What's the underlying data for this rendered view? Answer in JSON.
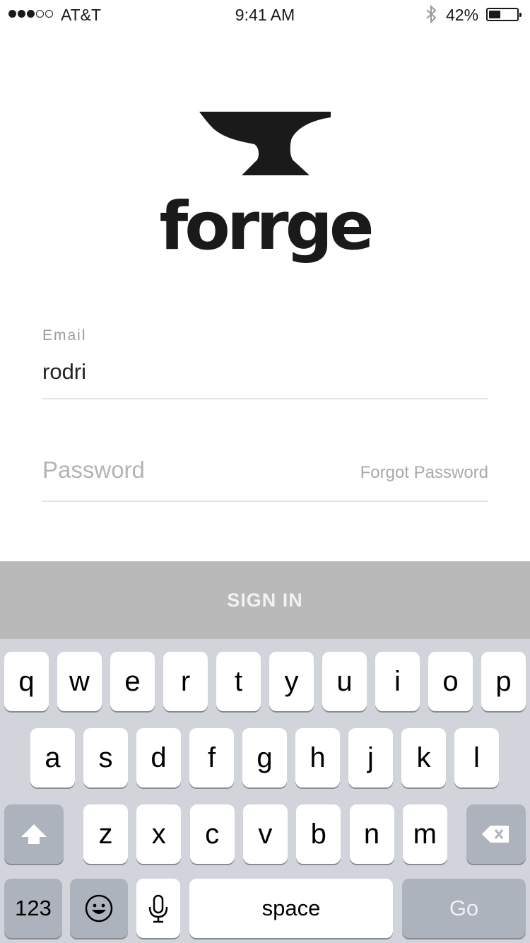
{
  "status_bar": {
    "carrier": "AT&T",
    "time": "9:41 AM",
    "battery_percent": "42%",
    "battery_level": 0.42,
    "signal_bars_filled": 3,
    "signal_bars_total": 5
  },
  "brand": {
    "name": "forrge"
  },
  "form": {
    "email_label": "Email",
    "email_value": "rodri",
    "password_placeholder": "Password",
    "forgot_password_label": "Forgot Password",
    "sign_in_label": "SIGN IN"
  },
  "keyboard": {
    "row1": [
      "q",
      "w",
      "e",
      "r",
      "t",
      "y",
      "u",
      "i",
      "o",
      "p"
    ],
    "row2": [
      "a",
      "s",
      "d",
      "f",
      "g",
      "h",
      "j",
      "k",
      "l"
    ],
    "row3": [
      "z",
      "x",
      "c",
      "v",
      "b",
      "n",
      "m"
    ],
    "numbers_label": "123",
    "space_label": "space",
    "go_label": "Go"
  },
  "colors": {
    "sign_in_bar": "#b9b9b9",
    "keyboard_bg": "#d1d5db",
    "text": "#1a1a1a"
  }
}
